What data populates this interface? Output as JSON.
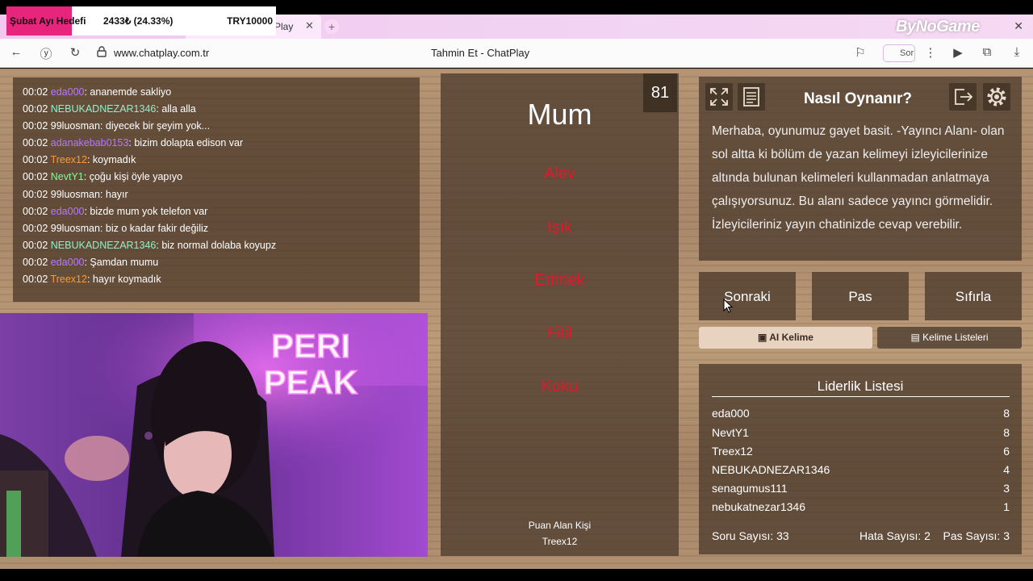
{
  "browser": {
    "tab_title": "Play",
    "url": "www.chatplay.com.tr",
    "page_title": "Tahmin Et - ChatPlay",
    "sor_label": "Sor"
  },
  "overlay": {
    "goal_label": "Şubat Ayı Hedefi",
    "goal_amount": "2433₺ (24.33%)",
    "goal_target": "TRY10000",
    "goal_progress": 0.2433,
    "brand": "ByNoGame"
  },
  "chat": {
    "messages": [
      {
        "time": "00:02",
        "user": "eda000",
        "color": "#b678ff",
        "text": ": ananemde sakliyo"
      },
      {
        "time": "00:02",
        "user": "NEBUKADNEZAR1346",
        "color": "#8ff0c9",
        "text": ": alla alla"
      },
      {
        "time": "00:02",
        "user": "99luosman",
        "color": "#ffffff",
        "text": ": diyecek bir şeyim yok..."
      },
      {
        "time": "00:02",
        "user": "adanakebab0153",
        "color": "#b678ff",
        "text": ": bizim dolapta edison var"
      },
      {
        "time": "00:02",
        "user": "Treex12",
        "color": "#ff9a2e",
        "text": ": koymadık"
      },
      {
        "time": "00:02",
        "user": "NevtY1",
        "color": "#8ff0a0",
        "text": ": çoğu kişi öyle yapıyo"
      },
      {
        "time": "00:02",
        "user": "99luosman",
        "color": "#ffffff",
        "text": ": hayır"
      },
      {
        "time": "00:02",
        "user": "eda000",
        "color": "#b678ff",
        "text": ": bizde mum yok telefon var"
      },
      {
        "time": "00:02",
        "user": "99luosman",
        "color": "#ffffff",
        "text": ": biz o kadar fakir değiliz"
      },
      {
        "time": "00:02",
        "user": "NEBUKADNEZAR1346",
        "color": "#8ff0c9",
        "text": ": biz normal dolaba koyupz"
      },
      {
        "time": "00:02",
        "user": "eda000",
        "color": "#b678ff",
        "text": ": Şamdan mumu"
      },
      {
        "time": "00:02",
        "user": "Treex12",
        "color": "#ff9a2e",
        "text": ": hayır koymadık"
      }
    ]
  },
  "webcam": {
    "sign_line1": "PERI",
    "sign_line2": "PEAK"
  },
  "game": {
    "counter": "81",
    "word": "Mum",
    "taboo_words": [
      "Alev",
      "Işık",
      "Erimek",
      "Fitil",
      "Koku"
    ],
    "scorer_label": "Puan Alan Kişi",
    "scorer_name": "Treex12"
  },
  "info": {
    "title": "Nasıl Oynanır?",
    "text": "Merhaba, oyunumuz gayet basit. -Yayıncı Alanı- olan sol altta ki bölüm de yazan kelimeyi izleyicilerinize altında bulunan kelimeleri kullanmadan anlatmaya çalışıyorsunuz. Bu alanı sadece yayıncı görmelidir. İzleyicileriniz yayın chatinizde cevap verebilir."
  },
  "actions": {
    "next": "Sonraki",
    "pass": "Pas",
    "reset": "Sıfırla",
    "ai_word": "AI Kelime",
    "word_lists": "Kelime Listeleri"
  },
  "leaderboard": {
    "title": "Liderlik Listesi",
    "rows": [
      {
        "name": "eda000",
        "score": "8"
      },
      {
        "name": "NevtY1",
        "score": "8"
      },
      {
        "name": "Treex12",
        "score": "6"
      },
      {
        "name": "NEBUKADNEZAR1346",
        "score": "4"
      },
      {
        "name": "senagumus111",
        "score": "3"
      },
      {
        "name": "nebukatnezar1346",
        "score": "1"
      }
    ],
    "question_count": "Soru Sayısı: 33",
    "error_count": "Hata Sayısı: 2",
    "pass_count": "Pas Sayısı: 3"
  }
}
